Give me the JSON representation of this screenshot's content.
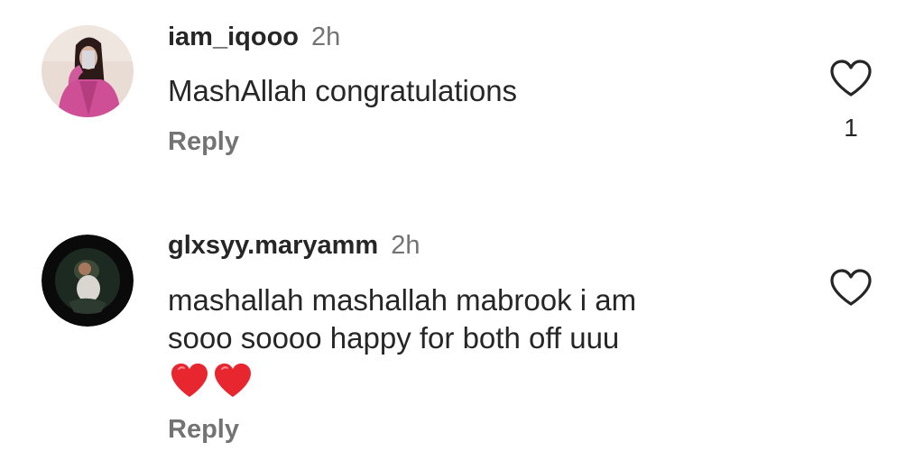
{
  "comments": [
    {
      "username": "iam_iqooo",
      "time": "2h",
      "text_lines": [
        "MashAllah congratulations"
      ],
      "emoji": "",
      "reply_label": "Reply",
      "like_count": "1",
      "avatar_icon": "profile-photo-pink-jacket"
    },
    {
      "username": "glxsyy.maryamm",
      "time": "2h",
      "text_lines": [
        "mashallah mashallah mabrook i am",
        "sooo soooo happy for both off uuu"
      ],
      "emoji": "❤️❤️",
      "reply_label": "Reply",
      "like_count": "",
      "avatar_icon": "profile-photo-dark-ring"
    }
  ],
  "colors": {
    "text": "#262626",
    "secondary": "#737373",
    "heart_emoji": "#e8262f"
  }
}
